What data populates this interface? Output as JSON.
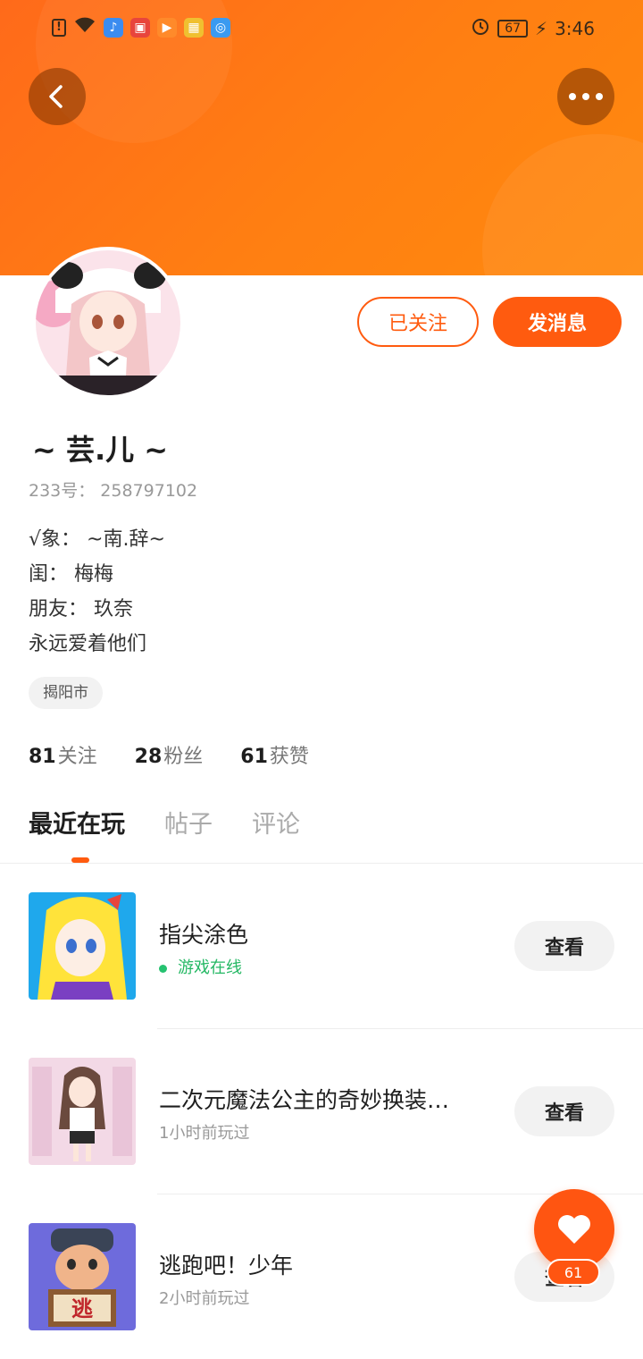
{
  "status_bar": {
    "battery": "67",
    "time": "3:46",
    "icons": [
      "alert-icon",
      "wifi-icon",
      "music-app-icon",
      "video-app-icon",
      "play-app-icon",
      "store-app-icon",
      "browser-app-icon",
      "alarm-icon",
      "charging-icon"
    ]
  },
  "colors": {
    "accent": "#ff5b0f",
    "header": "#ff7a14",
    "online": "#25b864"
  },
  "profile": {
    "nickname": "~ 芸.儿 ~",
    "uid": "233号： 258797102",
    "bio": [
      "√象： ~南.辞~",
      "闺： 梅梅",
      "朋友： 玖奈",
      "永远爱着他们"
    ],
    "location": "揭阳市",
    "follow_label": "已关注",
    "message_label": "发消息"
  },
  "stats": [
    {
      "num": "81",
      "label": "关注"
    },
    {
      "num": "28",
      "label": "粉丝"
    },
    {
      "num": "61",
      "label": "获赞"
    }
  ],
  "tabs": [
    "最近在玩",
    "帖子",
    "评论"
  ],
  "games": [
    {
      "title": "指尖涂色",
      "sub": "游戏在线",
      "action": "查看"
    },
    {
      "title": "二次元魔法公主的奇妙换装…",
      "sub": "1小时前玩过",
      "action": "查看"
    },
    {
      "title": "逃跑吧！少年",
      "sub": "2小时前玩过",
      "action": "查看"
    }
  ],
  "game3_sign": "逃",
  "like": {
    "count": "61"
  }
}
